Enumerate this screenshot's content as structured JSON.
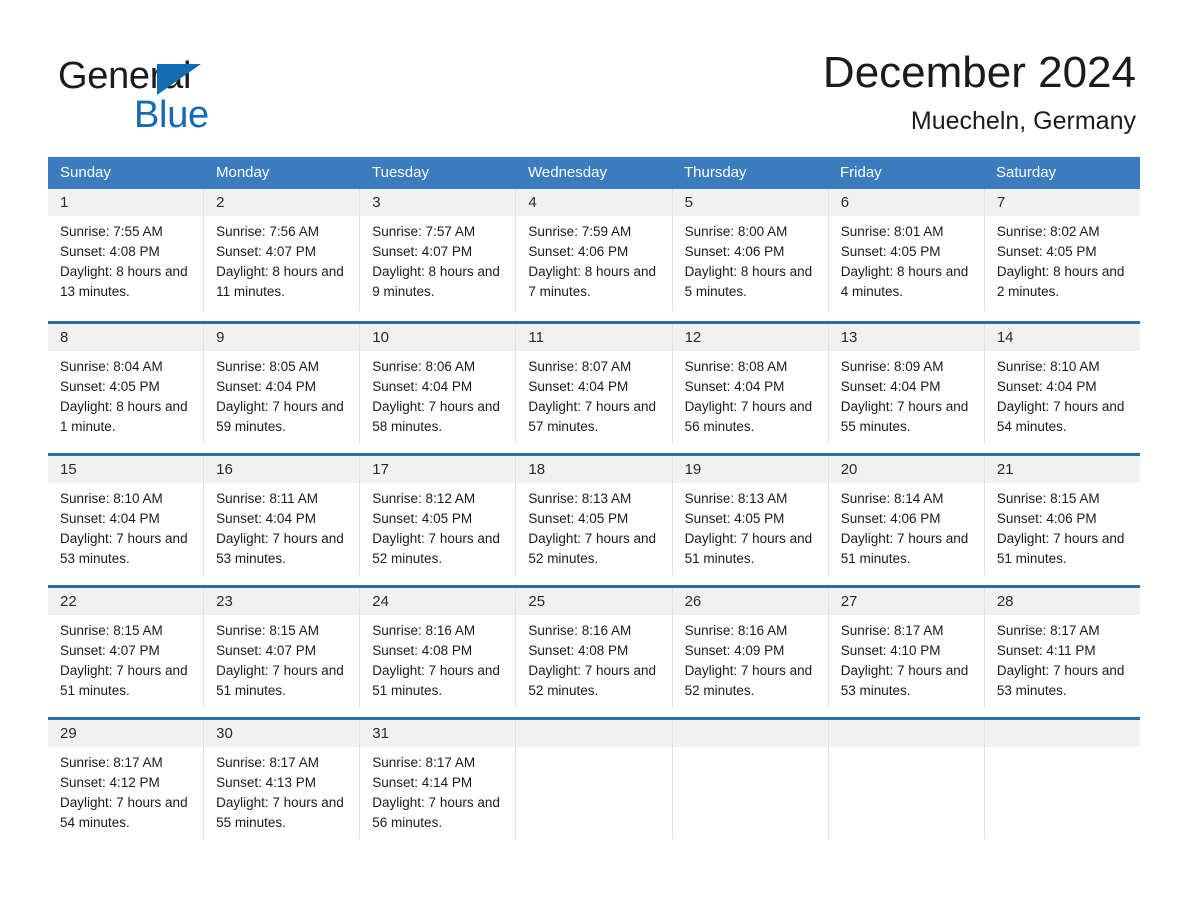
{
  "brand": {
    "line1": "General",
    "line2": "Blue",
    "triangle_color": "#136cb2"
  },
  "header": {
    "month_title": "December 2024",
    "location": "Muecheln, Germany"
  },
  "theme": {
    "header_bar": "#3a7cbe",
    "row_rule": "#2e6da4",
    "daynum_band": "#f1f1f1",
    "column_divider": "#e2e2e2"
  },
  "calendar": {
    "weekday_headers": [
      "Sunday",
      "Monday",
      "Tuesday",
      "Wednesday",
      "Thursday",
      "Friday",
      "Saturday"
    ],
    "weeks": [
      [
        {
          "day": "1",
          "sunrise": "Sunrise: 7:55 AM",
          "sunset": "Sunset: 4:08 PM",
          "daylight": "Daylight: 8 hours and 13 minutes."
        },
        {
          "day": "2",
          "sunrise": "Sunrise: 7:56 AM",
          "sunset": "Sunset: 4:07 PM",
          "daylight": "Daylight: 8 hours and 11 minutes."
        },
        {
          "day": "3",
          "sunrise": "Sunrise: 7:57 AM",
          "sunset": "Sunset: 4:07 PM",
          "daylight": "Daylight: 8 hours and 9 minutes."
        },
        {
          "day": "4",
          "sunrise": "Sunrise: 7:59 AM",
          "sunset": "Sunset: 4:06 PM",
          "daylight": "Daylight: 8 hours and 7 minutes."
        },
        {
          "day": "5",
          "sunrise": "Sunrise: 8:00 AM",
          "sunset": "Sunset: 4:06 PM",
          "daylight": "Daylight: 8 hours and 5 minutes."
        },
        {
          "day": "6",
          "sunrise": "Sunrise: 8:01 AM",
          "sunset": "Sunset: 4:05 PM",
          "daylight": "Daylight: 8 hours and 4 minutes."
        },
        {
          "day": "7",
          "sunrise": "Sunrise: 8:02 AM",
          "sunset": "Sunset: 4:05 PM",
          "daylight": "Daylight: 8 hours and 2 minutes."
        }
      ],
      [
        {
          "day": "8",
          "sunrise": "Sunrise: 8:04 AM",
          "sunset": "Sunset: 4:05 PM",
          "daylight": "Daylight: 8 hours and 1 minute."
        },
        {
          "day": "9",
          "sunrise": "Sunrise: 8:05 AM",
          "sunset": "Sunset: 4:04 PM",
          "daylight": "Daylight: 7 hours and 59 minutes."
        },
        {
          "day": "10",
          "sunrise": "Sunrise: 8:06 AM",
          "sunset": "Sunset: 4:04 PM",
          "daylight": "Daylight: 7 hours and 58 minutes."
        },
        {
          "day": "11",
          "sunrise": "Sunrise: 8:07 AM",
          "sunset": "Sunset: 4:04 PM",
          "daylight": "Daylight: 7 hours and 57 minutes."
        },
        {
          "day": "12",
          "sunrise": "Sunrise: 8:08 AM",
          "sunset": "Sunset: 4:04 PM",
          "daylight": "Daylight: 7 hours and 56 minutes."
        },
        {
          "day": "13",
          "sunrise": "Sunrise: 8:09 AM",
          "sunset": "Sunset: 4:04 PM",
          "daylight": "Daylight: 7 hours and 55 minutes."
        },
        {
          "day": "14",
          "sunrise": "Sunrise: 8:10 AM",
          "sunset": "Sunset: 4:04 PM",
          "daylight": "Daylight: 7 hours and 54 minutes."
        }
      ],
      [
        {
          "day": "15",
          "sunrise": "Sunrise: 8:10 AM",
          "sunset": "Sunset: 4:04 PM",
          "daylight": "Daylight: 7 hours and 53 minutes."
        },
        {
          "day": "16",
          "sunrise": "Sunrise: 8:11 AM",
          "sunset": "Sunset: 4:04 PM",
          "daylight": "Daylight: 7 hours and 53 minutes."
        },
        {
          "day": "17",
          "sunrise": "Sunrise: 8:12 AM",
          "sunset": "Sunset: 4:05 PM",
          "daylight": "Daylight: 7 hours and 52 minutes."
        },
        {
          "day": "18",
          "sunrise": "Sunrise: 8:13 AM",
          "sunset": "Sunset: 4:05 PM",
          "daylight": "Daylight: 7 hours and 52 minutes."
        },
        {
          "day": "19",
          "sunrise": "Sunrise: 8:13 AM",
          "sunset": "Sunset: 4:05 PM",
          "daylight": "Daylight: 7 hours and 51 minutes."
        },
        {
          "day": "20",
          "sunrise": "Sunrise: 8:14 AM",
          "sunset": "Sunset: 4:06 PM",
          "daylight": "Daylight: 7 hours and 51 minutes."
        },
        {
          "day": "21",
          "sunrise": "Sunrise: 8:15 AM",
          "sunset": "Sunset: 4:06 PM",
          "daylight": "Daylight: 7 hours and 51 minutes."
        }
      ],
      [
        {
          "day": "22",
          "sunrise": "Sunrise: 8:15 AM",
          "sunset": "Sunset: 4:07 PM",
          "daylight": "Daylight: 7 hours and 51 minutes."
        },
        {
          "day": "23",
          "sunrise": "Sunrise: 8:15 AM",
          "sunset": "Sunset: 4:07 PM",
          "daylight": "Daylight: 7 hours and 51 minutes."
        },
        {
          "day": "24",
          "sunrise": "Sunrise: 8:16 AM",
          "sunset": "Sunset: 4:08 PM",
          "daylight": "Daylight: 7 hours and 51 minutes."
        },
        {
          "day": "25",
          "sunrise": "Sunrise: 8:16 AM",
          "sunset": "Sunset: 4:08 PM",
          "daylight": "Daylight: 7 hours and 52 minutes."
        },
        {
          "day": "26",
          "sunrise": "Sunrise: 8:16 AM",
          "sunset": "Sunset: 4:09 PM",
          "daylight": "Daylight: 7 hours and 52 minutes."
        },
        {
          "day": "27",
          "sunrise": "Sunrise: 8:17 AM",
          "sunset": "Sunset: 4:10 PM",
          "daylight": "Daylight: 7 hours and 53 minutes."
        },
        {
          "day": "28",
          "sunrise": "Sunrise: 8:17 AM",
          "sunset": "Sunset: 4:11 PM",
          "daylight": "Daylight: 7 hours and 53 minutes."
        }
      ],
      [
        {
          "day": "29",
          "sunrise": "Sunrise: 8:17 AM",
          "sunset": "Sunset: 4:12 PM",
          "daylight": "Daylight: 7 hours and 54 minutes."
        },
        {
          "day": "30",
          "sunrise": "Sunrise: 8:17 AM",
          "sunset": "Sunset: 4:13 PM",
          "daylight": "Daylight: 7 hours and 55 minutes."
        },
        {
          "day": "31",
          "sunrise": "Sunrise: 8:17 AM",
          "sunset": "Sunset: 4:14 PM",
          "daylight": "Daylight: 7 hours and 56 minutes."
        },
        {
          "day": "",
          "sunrise": "",
          "sunset": "",
          "daylight": ""
        },
        {
          "day": "",
          "sunrise": "",
          "sunset": "",
          "daylight": ""
        },
        {
          "day": "",
          "sunrise": "",
          "sunset": "",
          "daylight": ""
        },
        {
          "day": "",
          "sunrise": "",
          "sunset": "",
          "daylight": ""
        }
      ]
    ]
  }
}
